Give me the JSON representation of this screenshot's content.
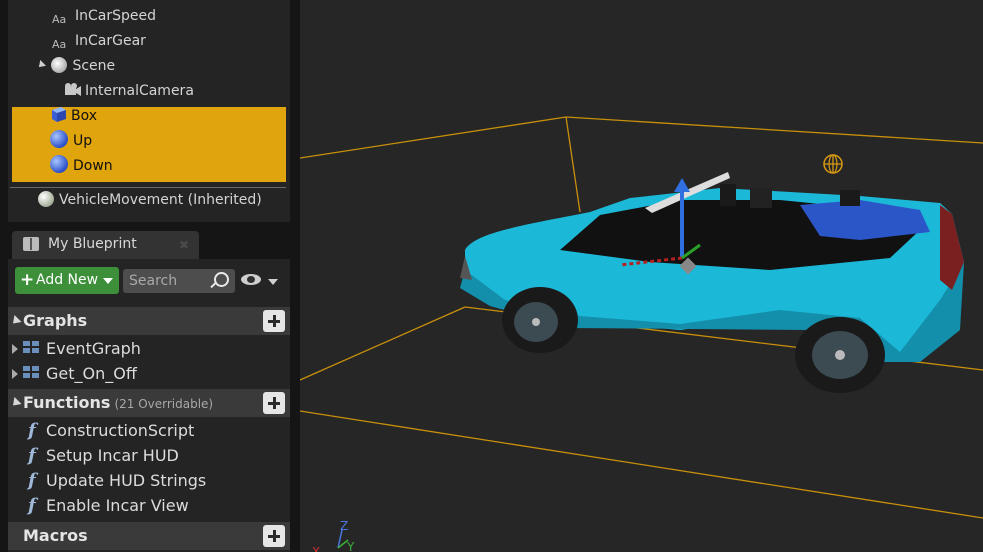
{
  "components": {
    "items": [
      {
        "label": "InCarSpeed",
        "icon": "text-render-icon"
      },
      {
        "label": "InCarGear",
        "icon": "text-render-icon"
      },
      {
        "label": "Scene",
        "icon": "scene-component-icon"
      },
      {
        "label": "InternalCamera",
        "icon": "camera-icon"
      },
      {
        "label": "Box",
        "icon": "box-collision-icon"
      },
      {
        "label": "Up",
        "icon": "sphere-icon"
      },
      {
        "label": "Down",
        "icon": "sphere-icon"
      },
      {
        "label": "VehicleMovement (Inherited)",
        "icon": "movement-component-icon"
      }
    ],
    "text_render_glyph": "Aa"
  },
  "my_blueprint": {
    "tab_label": "My Blueprint",
    "add_new_label": "Add New",
    "search_placeholder": "Search"
  },
  "sections": {
    "graphs": {
      "title": "Graphs",
      "items": [
        "EventGraph",
        "Get_On_Off"
      ]
    },
    "functions": {
      "title": "Functions",
      "subtitle": "(21 Overridable)",
      "items": [
        "ConstructionScript",
        "Setup Incar HUD",
        "Update HUD Strings",
        "Enable Incar View"
      ]
    },
    "macros": {
      "title": "Macros"
    }
  },
  "viewport": {
    "axis_labels": {
      "z": "Z",
      "y": "Y",
      "x": "X"
    }
  },
  "colors": {
    "selection": "#e0a40c",
    "add_new_green": "#3d8f39",
    "car_body": "#1cb8d8",
    "bounding_box": "#c8900a",
    "gizmo_arrow": "#2f6fe0"
  }
}
